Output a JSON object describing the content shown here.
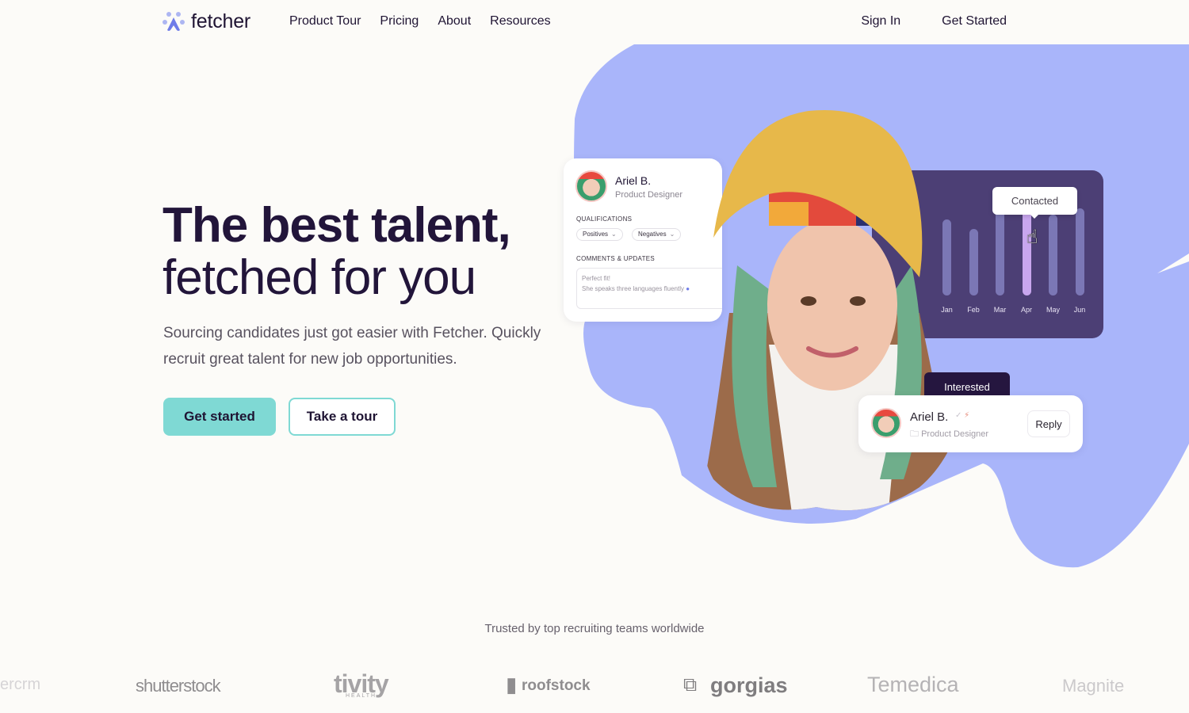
{
  "nav": {
    "brand": "fetcher",
    "links": [
      "Product Tour",
      "Pricing",
      "About",
      "Resources"
    ],
    "sign_in": "Sign In",
    "get_started": "Get Started"
  },
  "hero": {
    "title_line1": "The best talent,",
    "title_line2": "fetched for you",
    "subtitle": "Sourcing candidates just got easier with Fetcher. Quickly recruit great talent for new job opportunities.",
    "cta_primary": "Get started",
    "cta_secondary": "Take a tour"
  },
  "profile_card": {
    "name": "Ariel B.",
    "role": "Product Designer",
    "qualifications_label": "QUALIFICATIONS",
    "filters": [
      "Positives",
      "Negatives"
    ],
    "comments_label": "COMMENTS & UPDATES",
    "comment_line1": "Perfect fit!",
    "comment_line2": "She speaks three languages fluently"
  },
  "chart_card": {
    "tooltip": "Contacted",
    "active_month": "Apr",
    "colors": {
      "background": "#4c3f75",
      "bar": "#7b77b5",
      "active_bar": "#c8a6ee"
    }
  },
  "chart_data": {
    "type": "bar",
    "title": "",
    "categories": [
      "Jan",
      "Feb",
      "Mar",
      "Apr",
      "May",
      "Jun"
    ],
    "values": [
      80,
      70,
      90,
      90,
      85,
      92
    ],
    "xlabel": "",
    "ylabel": "",
    "ylim": [
      0,
      100
    ],
    "grid": false,
    "highlighted": "Apr",
    "annotation": "Contacted"
  },
  "reply_card": {
    "status": "Interested",
    "name": "Ariel B.",
    "role": "Product Designer",
    "reply_label": "Reply"
  },
  "trusted": {
    "heading": "Trusted by top recruiting teams worldwide",
    "brands": [
      "ercrm",
      "shutterstock",
      "tivity",
      "roofstock",
      "gorgias",
      "Temedica",
      "Magnite"
    ],
    "tivity_sub": "HEALTH"
  },
  "colors": {
    "accent_teal": "#7fd9d4",
    "blob_blue": "#a9b5fa",
    "text_dark": "#22153a"
  }
}
